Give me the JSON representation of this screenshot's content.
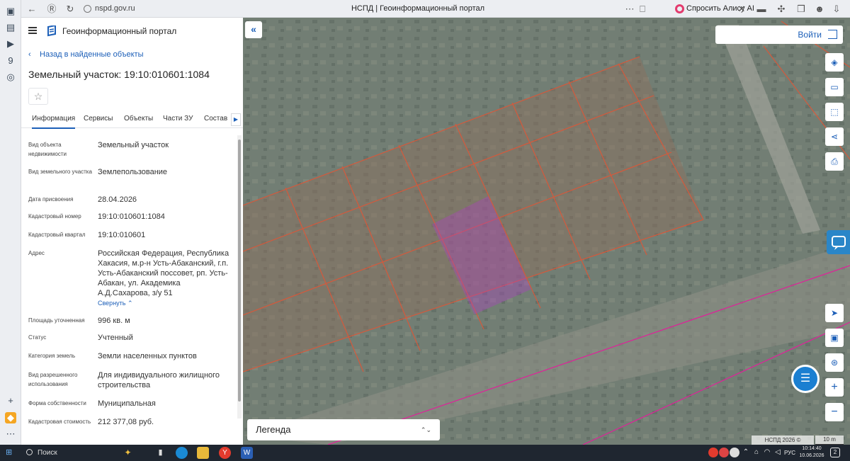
{
  "browser": {
    "url": "nspd.gov.ru",
    "page_title": "НСПД | Геоинформационный портал",
    "alice_label": "Спросить Алису AI"
  },
  "sidebar": {
    "app_name": "Геоинформационный портал",
    "back_link": "Назад в найденные объекты",
    "object_title": "Земельный участок: 19:10:010601:1084",
    "tabs": [
      {
        "label": "Информация",
        "active": true
      },
      {
        "label": "Сервисы",
        "active": false
      },
      {
        "label": "Объекты",
        "active": false
      },
      {
        "label": "Части ЗУ",
        "active": false
      },
      {
        "label": "Состав",
        "active": false
      }
    ],
    "info": [
      {
        "label": "Вид объекта недвижимости",
        "value": "Земельный участок"
      },
      {
        "label": "Вид земельного участка",
        "value": "Землепользование"
      },
      {
        "label": "Дата присвоения",
        "value": "28.04.2026"
      },
      {
        "label": "Кадастровый номер",
        "value": "19:10:010601:1084"
      },
      {
        "label": "Кадастровый квартал",
        "value": "19:10:010601"
      },
      {
        "label": "Адрес",
        "value": "Российская Федерация, Республика Хакасия, м.р-н Усть-Абаканский, г.п. Усть-Абаканский поссовет, рп. Усть-Абакан, ул. Академика А.Д.Сахарова, з/у 51"
      },
      {
        "label": "Площадь уточненная",
        "value": "996 кв. м"
      },
      {
        "label": "Статус",
        "value": "Учтенный"
      },
      {
        "label": "Категория земель",
        "value": "Земли населенных пунктов"
      },
      {
        "label": "Вид разрешенного использования",
        "value": "Для индивидуального жилищного строительства"
      },
      {
        "label": "Форма собственности",
        "value": "Муниципальная"
      },
      {
        "label": "Кадастровая стоимость",
        "value": "212 377,08 руб."
      }
    ],
    "collapse_label": "Свернуть"
  },
  "map": {
    "login_label": "Войти",
    "legend_label": "Легенда",
    "attribution": "НСПД 2026 ©",
    "scale_label": "10 m",
    "colors": {
      "parcel_border": "#d9583a",
      "selected_parcel": "#b23cc9",
      "boundary_line": "#e0209a",
      "accent": "#1c5fb8"
    },
    "tools": [
      "layers-icon",
      "ruler-icon",
      "select-area-icon",
      "share-icon",
      "print-icon",
      "locate-icon",
      "minimap-icon",
      "geolocation-icon",
      "zoom-in-icon",
      "zoom-out-icon"
    ],
    "zoom_in": "+",
    "zoom_out": "−"
  },
  "taskbar": {
    "search_label": "Поиск",
    "language": "РУС",
    "time": "10:14:40",
    "date": "10.06.2026"
  }
}
